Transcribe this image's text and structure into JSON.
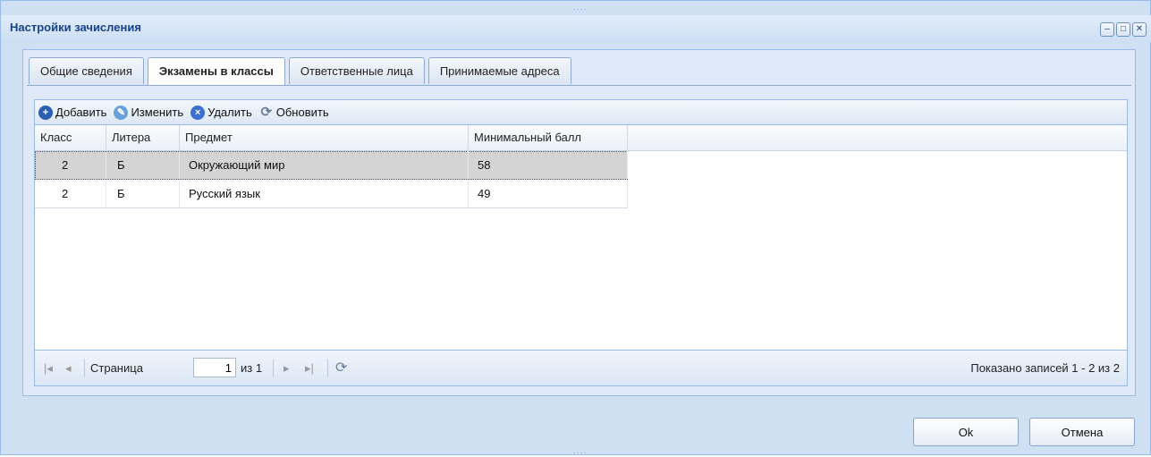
{
  "window": {
    "title": "Настройки зачисления",
    "controls": [
      "minimize-icon",
      "maximize-icon",
      "close-icon"
    ]
  },
  "tabs": [
    {
      "label": "Общие сведения",
      "active": false
    },
    {
      "label": "Экзамены в классы",
      "active": true
    },
    {
      "label": "Ответственные лица",
      "active": false
    },
    {
      "label": "Принимаемые адреса",
      "active": false
    }
  ],
  "toolbar": {
    "add_label": "Добавить",
    "edit_label": "Изменить",
    "delete_label": "Удалить",
    "refresh_label": "Обновить"
  },
  "table": {
    "columns": [
      "Класс",
      "Литера",
      "Предмет",
      "Минимальный балл"
    ],
    "rows": [
      {
        "class": "2",
        "letter": "Б",
        "subject": "Окружающий мир",
        "min_score": "58",
        "selected": true
      },
      {
        "class": "2",
        "letter": "Б",
        "subject": "Русский язык",
        "min_score": "49",
        "selected": false
      }
    ]
  },
  "pager": {
    "page_label": "Страница",
    "page_value": "1",
    "of_label": "из 1",
    "info": "Показано записей 1 - 2 из 2"
  },
  "footer": {
    "ok_label": "Ok",
    "cancel_label": "Отмена"
  },
  "colors": {
    "window_bg": "#cfe0f3",
    "title_text": "#15428b",
    "selected_row": "#d4d4d4"
  }
}
